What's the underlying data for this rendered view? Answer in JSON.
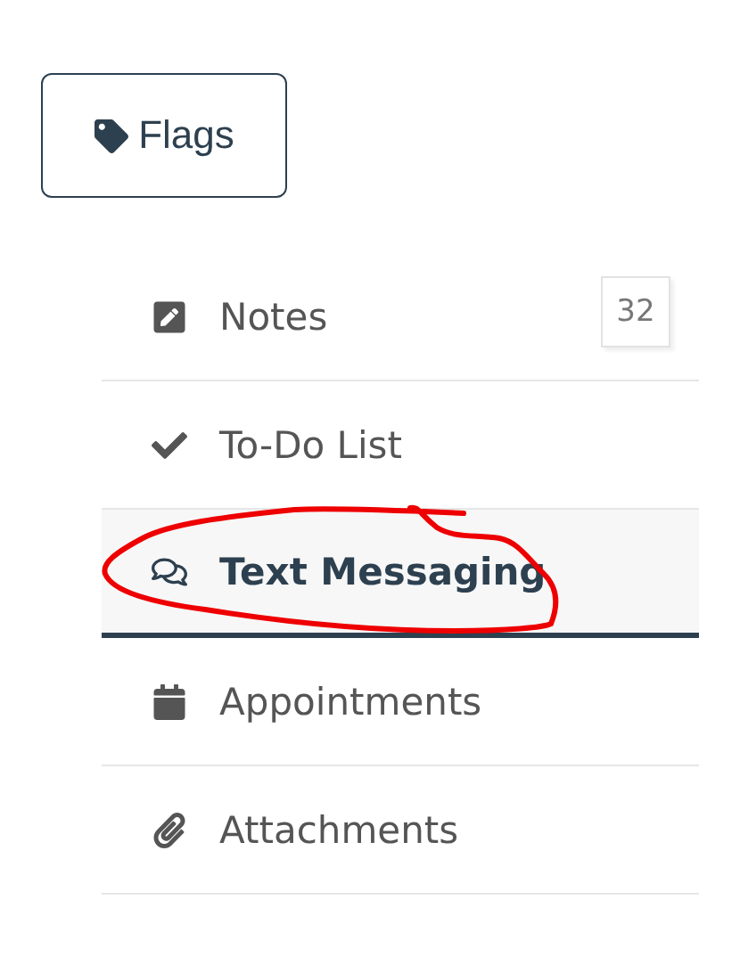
{
  "flags_button": {
    "label": "Flags"
  },
  "menu": [
    {
      "label": "Notes",
      "count": "32",
      "selected": false
    },
    {
      "label": "To-Do List",
      "selected": false
    },
    {
      "label": "Text Messaging",
      "selected": true
    },
    {
      "label": "Appointments",
      "selected": false
    },
    {
      "label": "Attachments",
      "selected": false
    }
  ]
}
